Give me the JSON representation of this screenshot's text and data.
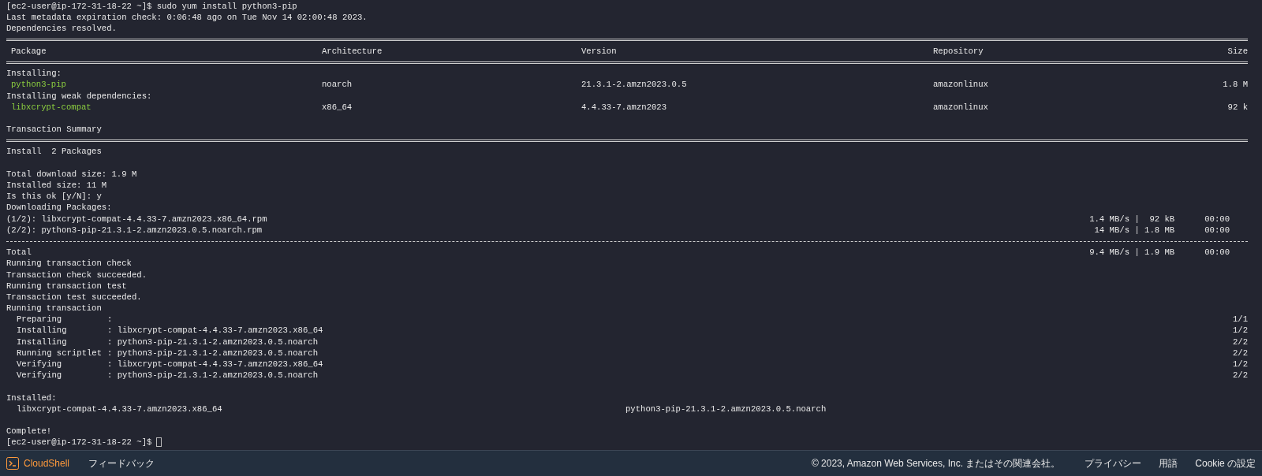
{
  "terminal": {
    "lines": [
      {
        "kind": "text",
        "text": "[ec2-user@ip-172-31-18-22 ~]$ sudo yum install python3-pip"
      },
      {
        "kind": "text",
        "text": "Last metadata expiration check: 0:06:48 ago on Tue Nov 14 02:00:48 2023."
      },
      {
        "kind": "text",
        "text": "Dependencies resolved."
      },
      {
        "kind": "double_rule"
      },
      {
        "kind": "header",
        "cells": [
          "Package",
          "Architecture",
          "Version",
          "Repository",
          "Size"
        ]
      },
      {
        "kind": "double_rule"
      },
      {
        "kind": "text",
        "text": "Installing:"
      },
      {
        "kind": "package",
        "cells": [
          "python3-pip",
          "noarch",
          "21.3.1-2.amzn2023.0.5",
          "amazonlinux",
          "1.8 M"
        ]
      },
      {
        "kind": "text",
        "text": "Installing weak dependencies:"
      },
      {
        "kind": "package",
        "cells": [
          "libxcrypt-compat",
          "x86_64",
          "4.4.33-7.amzn2023",
          "amazonlinux",
          "92 k"
        ]
      },
      {
        "kind": "blank"
      },
      {
        "kind": "text",
        "text": "Transaction Summary"
      },
      {
        "kind": "double_rule"
      },
      {
        "kind": "text",
        "text": "Install  2 Packages"
      },
      {
        "kind": "blank"
      },
      {
        "kind": "text",
        "text": "Total download size: 1.9 M"
      },
      {
        "kind": "text",
        "text": "Installed size: 11 M"
      },
      {
        "kind": "text",
        "text": "Is this ok [y/N]: y"
      },
      {
        "kind": "text",
        "text": "Downloading Packages:"
      },
      {
        "kind": "download",
        "text": "(1/2): libxcrypt-compat-4.4.33-7.amzn2023.x86_64.rpm",
        "speed": "1.4 MB/s |  92 kB",
        "time": "00:00"
      },
      {
        "kind": "download",
        "text": "(2/2): python3-pip-21.3.1-2.amzn2023.0.5.noarch.rpm",
        "speed": "14 MB/s | 1.8 MB",
        "time": "00:00"
      },
      {
        "kind": "dashed_rule"
      },
      {
        "kind": "download",
        "text": "Total",
        "speed": "9.4 MB/s | 1.9 MB",
        "time": "00:00"
      },
      {
        "kind": "text",
        "text": "Running transaction check"
      },
      {
        "kind": "text",
        "text": "Transaction check succeeded."
      },
      {
        "kind": "text",
        "text": "Running transaction test"
      },
      {
        "kind": "text",
        "text": "Transaction test succeeded."
      },
      {
        "kind": "text",
        "text": "Running transaction"
      },
      {
        "kind": "step",
        "label": "Preparing",
        "value": ":",
        "count": "1/1"
      },
      {
        "kind": "step",
        "label": "Installing",
        "value": ": libxcrypt-compat-4.4.33-7.amzn2023.x86_64",
        "count": "1/2"
      },
      {
        "kind": "step",
        "label": "Installing",
        "value": ": python3-pip-21.3.1-2.amzn2023.0.5.noarch",
        "count": "2/2"
      },
      {
        "kind": "step",
        "label": "Running scriptlet",
        "value": ": python3-pip-21.3.1-2.amzn2023.0.5.noarch",
        "count": "2/2"
      },
      {
        "kind": "step",
        "label": "Verifying",
        "value": ": libxcrypt-compat-4.4.33-7.amzn2023.x86_64",
        "count": "1/2"
      },
      {
        "kind": "step",
        "label": "Verifying",
        "value": ": python3-pip-21.3.1-2.amzn2023.0.5.noarch",
        "count": "2/2"
      },
      {
        "kind": "blank"
      },
      {
        "kind": "text",
        "text": "Installed:"
      },
      {
        "kind": "installed",
        "items": [
          "libxcrypt-compat-4.4.33-7.amzn2023.x86_64",
          "python3-pip-21.3.1-2.amzn2023.0.5.noarch"
        ]
      },
      {
        "kind": "blank"
      },
      {
        "kind": "text",
        "text": "Complete!"
      },
      {
        "kind": "prompt",
        "text": "[ec2-user@ip-172-31-18-22 ~]$"
      }
    ]
  },
  "footer": {
    "app": "CloudShell",
    "feedback": "フィードバック",
    "copyright": "© 2023, Amazon Web Services, Inc. またはその関連会社。",
    "links": [
      "プライバシー",
      "用語",
      "Cookie の設定"
    ]
  }
}
